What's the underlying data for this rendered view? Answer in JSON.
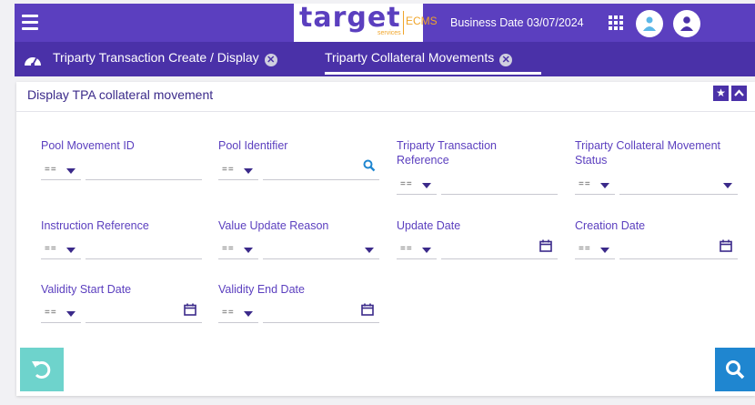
{
  "header": {
    "logo_text": "target",
    "logo_sub": "services",
    "logo_product": "ECMS",
    "business_date_label": "Business Date 03/07/2024"
  },
  "tabs": [
    {
      "label": "Triparty Transaction Create / Display"
    },
    {
      "label": "Triparty Collateral Movements"
    }
  ],
  "panel": {
    "title": "Display TPA collateral movement"
  },
  "fields": {
    "pool_movement_id": {
      "label": "Pool Movement ID",
      "operator": "==",
      "value": ""
    },
    "pool_identifier": {
      "label": "Pool Identifier",
      "operator": "==",
      "value": ""
    },
    "triparty_transaction_reference": {
      "label_line1": "Triparty Transaction",
      "label_line2": "Reference",
      "operator": "==",
      "value": ""
    },
    "triparty_collateral_movement_status": {
      "label_line1": "Triparty Collateral Movement",
      "label_line2": "Status",
      "operator": "==",
      "value": ""
    },
    "instruction_reference": {
      "label": "Instruction Reference",
      "operator": "==",
      "value": ""
    },
    "value_update_reason": {
      "label": "Value Update Reason",
      "operator": "==",
      "value": ""
    },
    "update_date": {
      "label": "Update Date",
      "operator": "==",
      "value": ""
    },
    "creation_date": {
      "label": "Creation Date",
      "operator": "==",
      "value": ""
    },
    "validity_start_date": {
      "label": "Validity Start Date",
      "operator": "==",
      "value": ""
    },
    "validity_end_date": {
      "label": "Validity End Date",
      "operator": "==",
      "value": ""
    }
  },
  "icons": {
    "menu": "hamburger-icon",
    "apps": "grid-icon",
    "notifications": "person-icon",
    "account": "user-icon",
    "dashboard": "speedometer-icon",
    "favorite": "star-icon",
    "collapse": "chevron-up-icon",
    "reset": "reset-icon",
    "search": "search-icon",
    "calendar": "calendar-icon"
  },
  "colors": {
    "primary": "#5b3fbf",
    "tab_bar": "#4a31a8",
    "accent_orange": "#f0a52a",
    "reset_button": "#6ed3cc",
    "search_button": "#1f86d0"
  }
}
